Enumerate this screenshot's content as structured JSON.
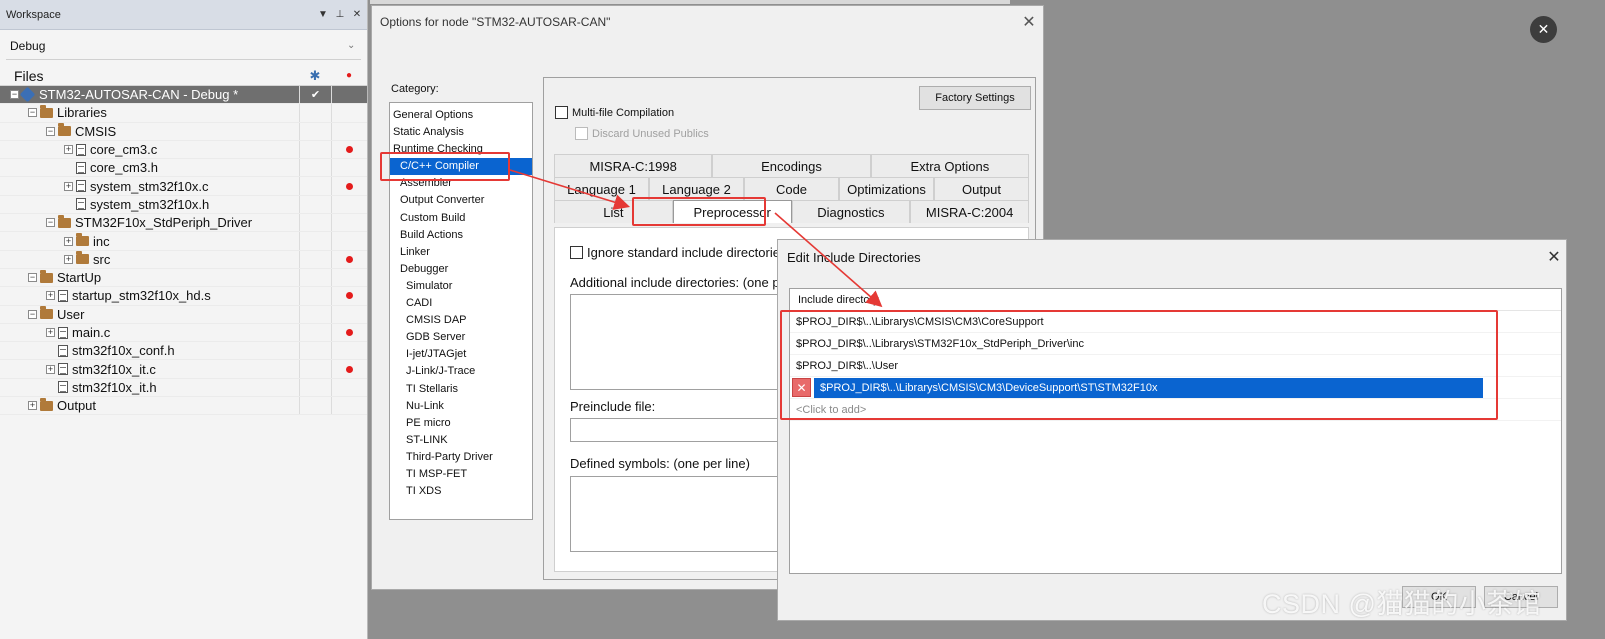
{
  "workspace": {
    "title": "Workspace",
    "configuration": "Debug",
    "files_label": "Files",
    "root_check": "✔",
    "tree": [
      {
        "label": "STM32-AUTOSAR-CAN - Debug *",
        "level": 0,
        "kind": "project",
        "exp": "−",
        "dot": false
      },
      {
        "label": "Libraries",
        "level": 1,
        "kind": "folder",
        "exp": "−",
        "dot": false
      },
      {
        "label": "CMSIS",
        "level": 2,
        "kind": "folder",
        "exp": "−",
        "dot": false
      },
      {
        "label": "core_cm3.c",
        "level": 3,
        "kind": "file",
        "exp": "+",
        "dot": true
      },
      {
        "label": "core_cm3.h",
        "level": 3,
        "kind": "file",
        "exp": "",
        "dot": false
      },
      {
        "label": "system_stm32f10x.c",
        "level": 3,
        "kind": "file",
        "exp": "+",
        "dot": true
      },
      {
        "label": "system_stm32f10x.h",
        "level": 3,
        "kind": "file",
        "exp": "",
        "dot": false
      },
      {
        "label": "STM32F10x_StdPeriph_Driver",
        "level": 2,
        "kind": "folder",
        "exp": "−",
        "dot": false
      },
      {
        "label": "inc",
        "level": 3,
        "kind": "folder",
        "exp": "+",
        "dot": false
      },
      {
        "label": "src",
        "level": 3,
        "kind": "folder",
        "exp": "+",
        "dot": true
      },
      {
        "label": "StartUp",
        "level": 1,
        "kind": "folder",
        "exp": "−",
        "dot": false
      },
      {
        "label": "startup_stm32f10x_hd.s",
        "level": 2,
        "kind": "file",
        "exp": "+",
        "dot": true
      },
      {
        "label": "User",
        "level": 1,
        "kind": "folder",
        "exp": "−",
        "dot": false
      },
      {
        "label": "main.c",
        "level": 2,
        "kind": "file",
        "exp": "+",
        "dot": true
      },
      {
        "label": "stm32f10x_conf.h",
        "level": 2,
        "kind": "file",
        "exp": "",
        "dot": false
      },
      {
        "label": "stm32f10x_it.c",
        "level": 2,
        "kind": "file",
        "exp": "+",
        "dot": true
      },
      {
        "label": "stm32f10x_it.h",
        "level": 2,
        "kind": "file",
        "exp": "",
        "dot": false
      },
      {
        "label": "Output",
        "level": 1,
        "kind": "folder",
        "exp": "+",
        "dot": false
      }
    ]
  },
  "options_dialog": {
    "title": "Options for node \"STM32-AUTOSAR-CAN\"",
    "category_label": "Category:",
    "categories": [
      {
        "label": "General Options",
        "indent": 0
      },
      {
        "label": "Static Analysis",
        "indent": 0
      },
      {
        "label": "Runtime Checking",
        "indent": 0
      },
      {
        "label": "C/C++ Compiler",
        "indent": 1,
        "selected": true
      },
      {
        "label": "Assembler",
        "indent": 1
      },
      {
        "label": "Output Converter",
        "indent": 1
      },
      {
        "label": "Custom Build",
        "indent": 1
      },
      {
        "label": "Build Actions",
        "indent": 1
      },
      {
        "label": "Linker",
        "indent": 1
      },
      {
        "label": "Debugger",
        "indent": 1
      },
      {
        "label": "Simulator",
        "indent": 2
      },
      {
        "label": "CADI",
        "indent": 2
      },
      {
        "label": "CMSIS DAP",
        "indent": 2
      },
      {
        "label": "GDB Server",
        "indent": 2
      },
      {
        "label": "I-jet/JTAGjet",
        "indent": 2
      },
      {
        "label": "J-Link/J-Trace",
        "indent": 2
      },
      {
        "label": "TI Stellaris",
        "indent": 2
      },
      {
        "label": "Nu-Link",
        "indent": 2
      },
      {
        "label": "PE micro",
        "indent": 2
      },
      {
        "label": "ST-LINK",
        "indent": 2
      },
      {
        "label": "Third-Party Driver",
        "indent": 2
      },
      {
        "label": "TI MSP-FET",
        "indent": 2
      },
      {
        "label": "TI XDS",
        "indent": 2
      }
    ],
    "factory_settings": "Factory Settings",
    "multifile": "Multi-file Compilation",
    "discard_unused": "Discard Unused Publics",
    "tab_rows": [
      [
        "MISRA-C:1998",
        "Encodings",
        "Extra Options"
      ],
      [
        "Language 1",
        "Language 2",
        "Code",
        "Optimizations",
        "Output"
      ],
      [
        "List",
        "Preprocessor",
        "Diagnostics",
        "MISRA-C:2004"
      ]
    ],
    "active_tab": "Preprocessor",
    "ignore_std_include": "Ignore standard include directorie",
    "additional_include": "Additional include directories: (one p",
    "preinclude": "Preinclude file:",
    "defined_symbols": "Defined symbols: (one per line)"
  },
  "edit_dialog": {
    "title": "Edit Include Directories",
    "column_header": "Include directory",
    "rows": [
      "$PROJ_DIR$\\..\\Librarys\\CMSIS\\CM3\\CoreSupport",
      "$PROJ_DIR$\\..\\Librarys\\STM32F10x_StdPeriph_Driver\\inc",
      "$PROJ_DIR$\\..\\User"
    ],
    "selected_row": "$PROJ_DIR$\\..\\Librarys\\CMSIS\\CM3\\DeviceSupport\\ST\\STM32F10x",
    "add_row": "<Click to add>",
    "ok": "OK",
    "cancel": "Cancel"
  },
  "watermark": "CSDN @猫猫的小茶馆",
  "colors": {
    "selection": "#0a64d0",
    "highlight_box": "#e53935",
    "red_dot": "#e41b1b",
    "folder": "#b07a3a"
  }
}
